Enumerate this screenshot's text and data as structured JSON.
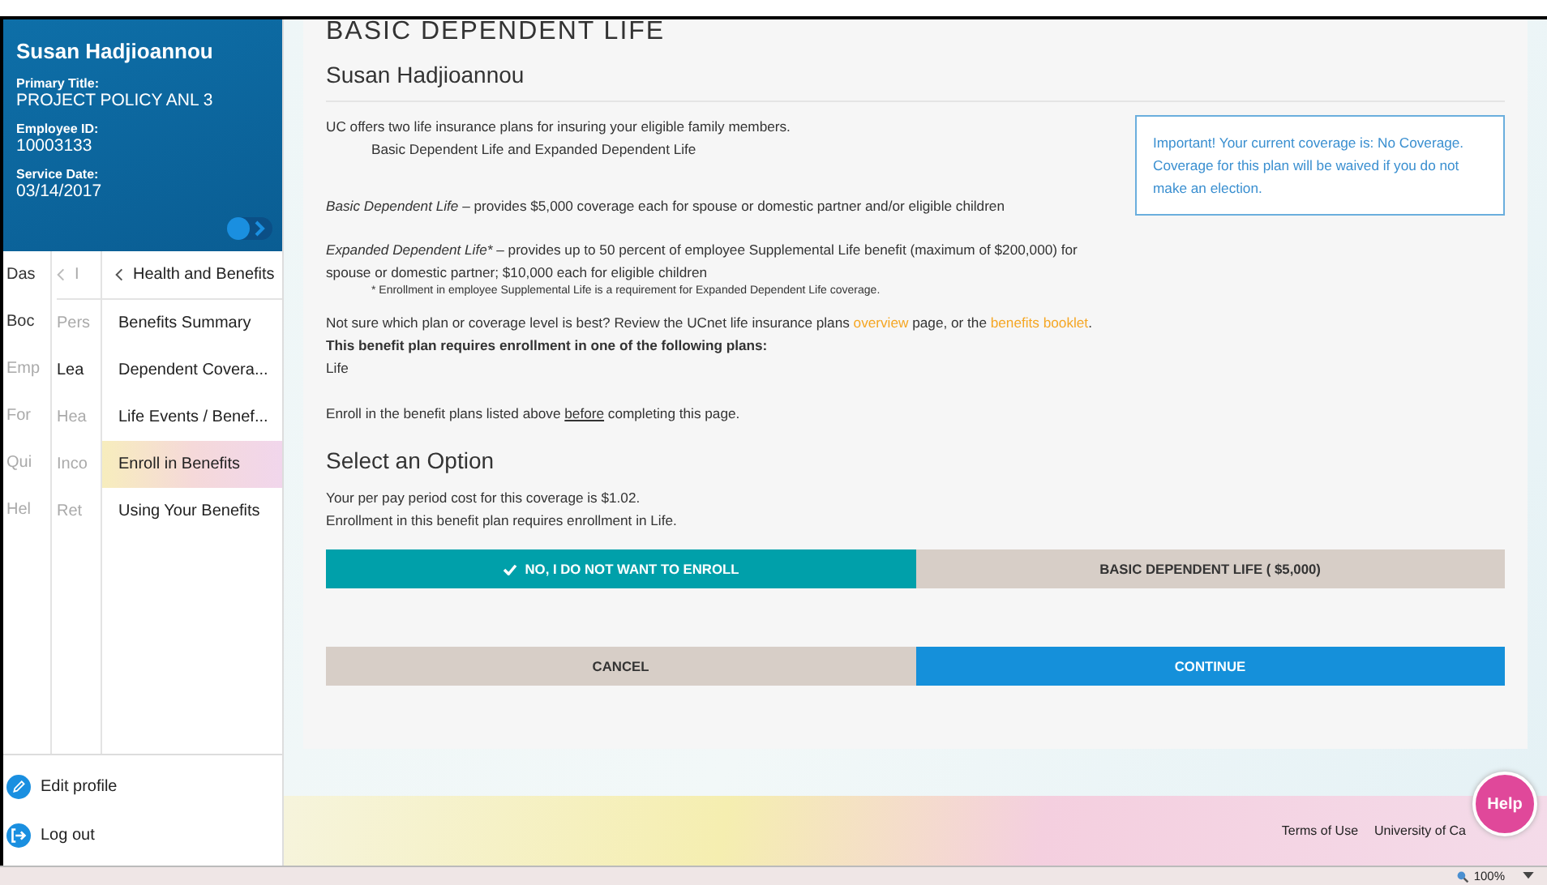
{
  "sidebar": {
    "profile": {
      "name": "Susan Hadjioannou",
      "fields": [
        {
          "label": "Primary Title:",
          "value": "PROJECT POLICY ANL 3"
        },
        {
          "label": "Employee ID:",
          "value": "10003133"
        },
        {
          "label": "Service Date:",
          "value": "03/14/2017"
        }
      ]
    },
    "menu_1": [
      {
        "label": "Das",
        "disabled": false
      },
      {
        "label": "Boc",
        "disabled": false
      },
      {
        "label": "Emp",
        "disabled": true
      },
      {
        "label": "For",
        "disabled": true
      },
      {
        "label": "Qui",
        "disabled": true
      },
      {
        "label": "Hel",
        "disabled": true
      }
    ],
    "menu_2": {
      "header": "I",
      "items": [
        {
          "label": "Pers",
          "disabled": true
        },
        {
          "label": "Lea",
          "disabled": false
        },
        {
          "label": "Hea",
          "disabled": true
        },
        {
          "label": "Inco",
          "disabled": true
        },
        {
          "label": "Ret",
          "disabled": true
        }
      ]
    },
    "menu_3": {
      "header": "Health and Benefits",
      "items": [
        {
          "label": "Benefits Summary",
          "selected": false
        },
        {
          "label": "Dependent Covera...",
          "selected": false
        },
        {
          "label": "Life Events / Benef...",
          "selected": false
        },
        {
          "label": "Enroll in Benefits",
          "selected": true
        },
        {
          "label": "Using Your Benefits",
          "selected": false
        }
      ]
    },
    "bottom_links": [
      {
        "label": "Edit profile",
        "kind": "edit"
      },
      {
        "label": "Log out",
        "kind": "logout"
      }
    ]
  },
  "main": {
    "title": "BASIC DEPENDENT LIFE",
    "name": "Susan Hadjioannou",
    "intro": "UC offers two life insurance plans for insuring your eligible family members.",
    "intro_sub": "Basic Dependent Life and Expanded Dependent Life",
    "plans": [
      {
        "term": "Basic Dependent Life",
        "text": "– provides $5,000 coverage each for spouse or domestic partner and/or eligible children"
      },
      {
        "term": "Expanded Dependent Life*",
        "text": "– provides up to 50 percent of employee Supplemental Life benefit (maximum of $200,000) for spouse or domestic partner; $10,000 each for eligible children"
      }
    ],
    "footnote": "* Enrollment in employee Supplemental Life is a requirement for Expanded Dependent Life coverage.",
    "review": [
      {
        "kind": "text",
        "text": "Not sure which plan or coverage level is best? Review the UCnet life insurance plans"
      },
      {
        "kind": "link",
        "text": "overview"
      },
      {
        "kind": "text",
        "text": "page, or the"
      },
      {
        "kind": "link",
        "text": "benefits booklet"
      },
      {
        "kind": "text",
        "text": "."
      }
    ],
    "requires": "This benefit plan requires enrollment in one of the following plans:",
    "required_plan": "Life",
    "enroll_note": [
      {
        "kind": "text",
        "text": "Enroll in the benefit plans listed above"
      },
      {
        "kind": "underline",
        "text": "before"
      },
      {
        "kind": "text",
        "text": "completing this page."
      }
    ],
    "notice": "Important! Your current coverage is: No Coverage. Coverage for this plan will be waived if you do not make an election.",
    "option_heading": "Select an Option",
    "cost": "Your per pay period cost for this coverage is $1.02.",
    "cost_note": "Enrollment in this benefit plan requires enrollment in Life.",
    "options": [
      {
        "label": "NO, I DO NOT WANT TO ENROLL",
        "selected": true
      },
      {
        "label": "BASIC DEPENDENT LIFE ( $5,000)",
        "selected": false
      }
    ],
    "buttons": [
      {
        "label": "CANCEL",
        "kind": "secondary"
      },
      {
        "label": "CONTINUE",
        "kind": "primary"
      }
    ]
  },
  "footer": {
    "links": [
      "Terms of Use",
      "University of Ca"
    ],
    "help": "Help"
  },
  "status_bar": {
    "zoom": "100%"
  }
}
